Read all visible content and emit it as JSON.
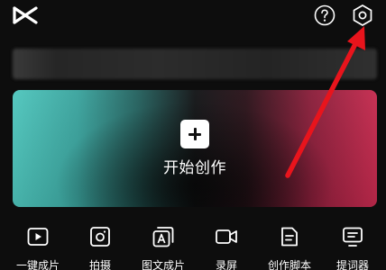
{
  "header": {
    "logo_icon": "capcut-logo-icon",
    "help_icon": "help-circle-icon",
    "settings_icon": "settings-hexagon-icon"
  },
  "create": {
    "label": "开始创作",
    "icon": "plus-icon"
  },
  "tools": [
    {
      "label": "一键成片",
      "icon": "play-square-icon"
    },
    {
      "label": "拍摄",
      "icon": "camera-icon"
    },
    {
      "label": "图文成片",
      "icon": "image-text-icon"
    },
    {
      "label": "录屏",
      "icon": "screen-record-icon"
    },
    {
      "label": "创作脚本",
      "icon": "script-document-icon"
    },
    {
      "label": "提词器",
      "icon": "teleprompter-icon"
    }
  ],
  "colors": {
    "background": "#0d0d0d",
    "card_gradient_left": "#4fc6bd",
    "card_gradient_right": "#c52a4e",
    "annotation_arrow": "#e8141c"
  }
}
